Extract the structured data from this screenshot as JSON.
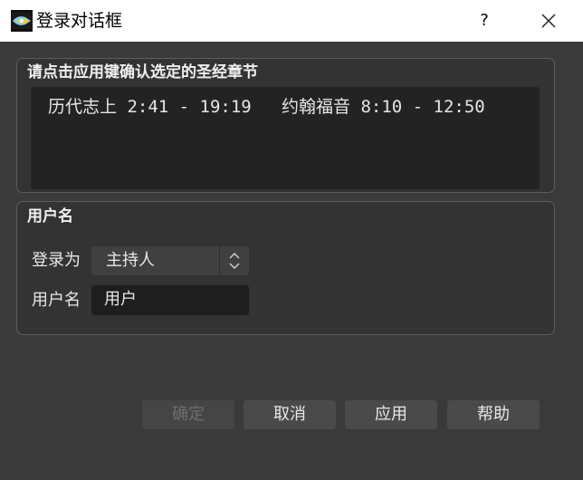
{
  "window": {
    "title": "登录对话框",
    "help_glyph": "?"
  },
  "verses_group": {
    "title": "请点击应用键确认选定的圣经章节",
    "items": [
      "历代志上 2:41 - 19:19",
      "约翰福音 8:10 - 12:50"
    ]
  },
  "user_group": {
    "title": "用户名",
    "login_label": "登录为",
    "login_value": "主持人",
    "username_label": "用户名",
    "username_value": "用户"
  },
  "buttons": {
    "ok": "确定",
    "cancel": "取消",
    "apply": "应用",
    "help": "帮助"
  },
  "colors": {
    "background": "#3a3a3a",
    "titlebar": "#ffffff",
    "panel": "#333333",
    "verse_box": "#232323",
    "button": "#4a4a4a",
    "disabled_text": "#6f6f6f"
  }
}
